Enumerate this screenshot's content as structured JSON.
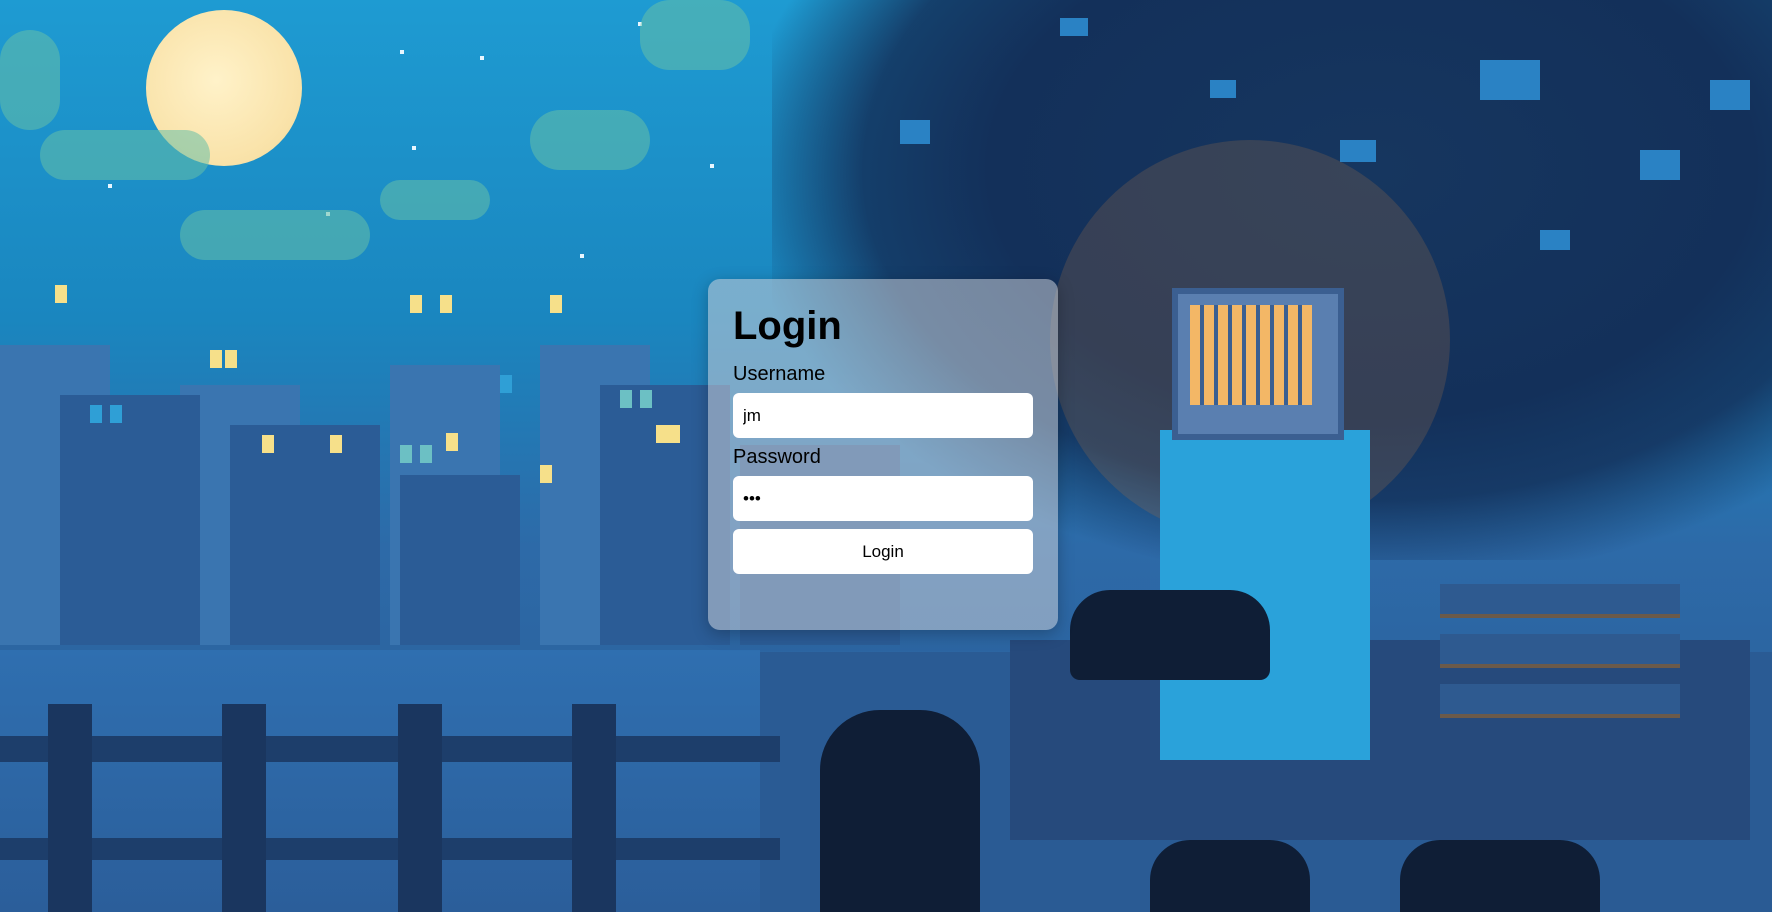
{
  "login": {
    "title": "Login",
    "username_label": "Username",
    "username_value": "jm",
    "password_label": "Password",
    "password_value": "•••",
    "submit_label": "Login"
  },
  "background": {
    "description_colors": {
      "sky": "#1e9bd2",
      "moon": "#f9e2a8",
      "city": "#2b5c96",
      "tree": "#13305a",
      "window_lit": "#f6e08a"
    }
  }
}
